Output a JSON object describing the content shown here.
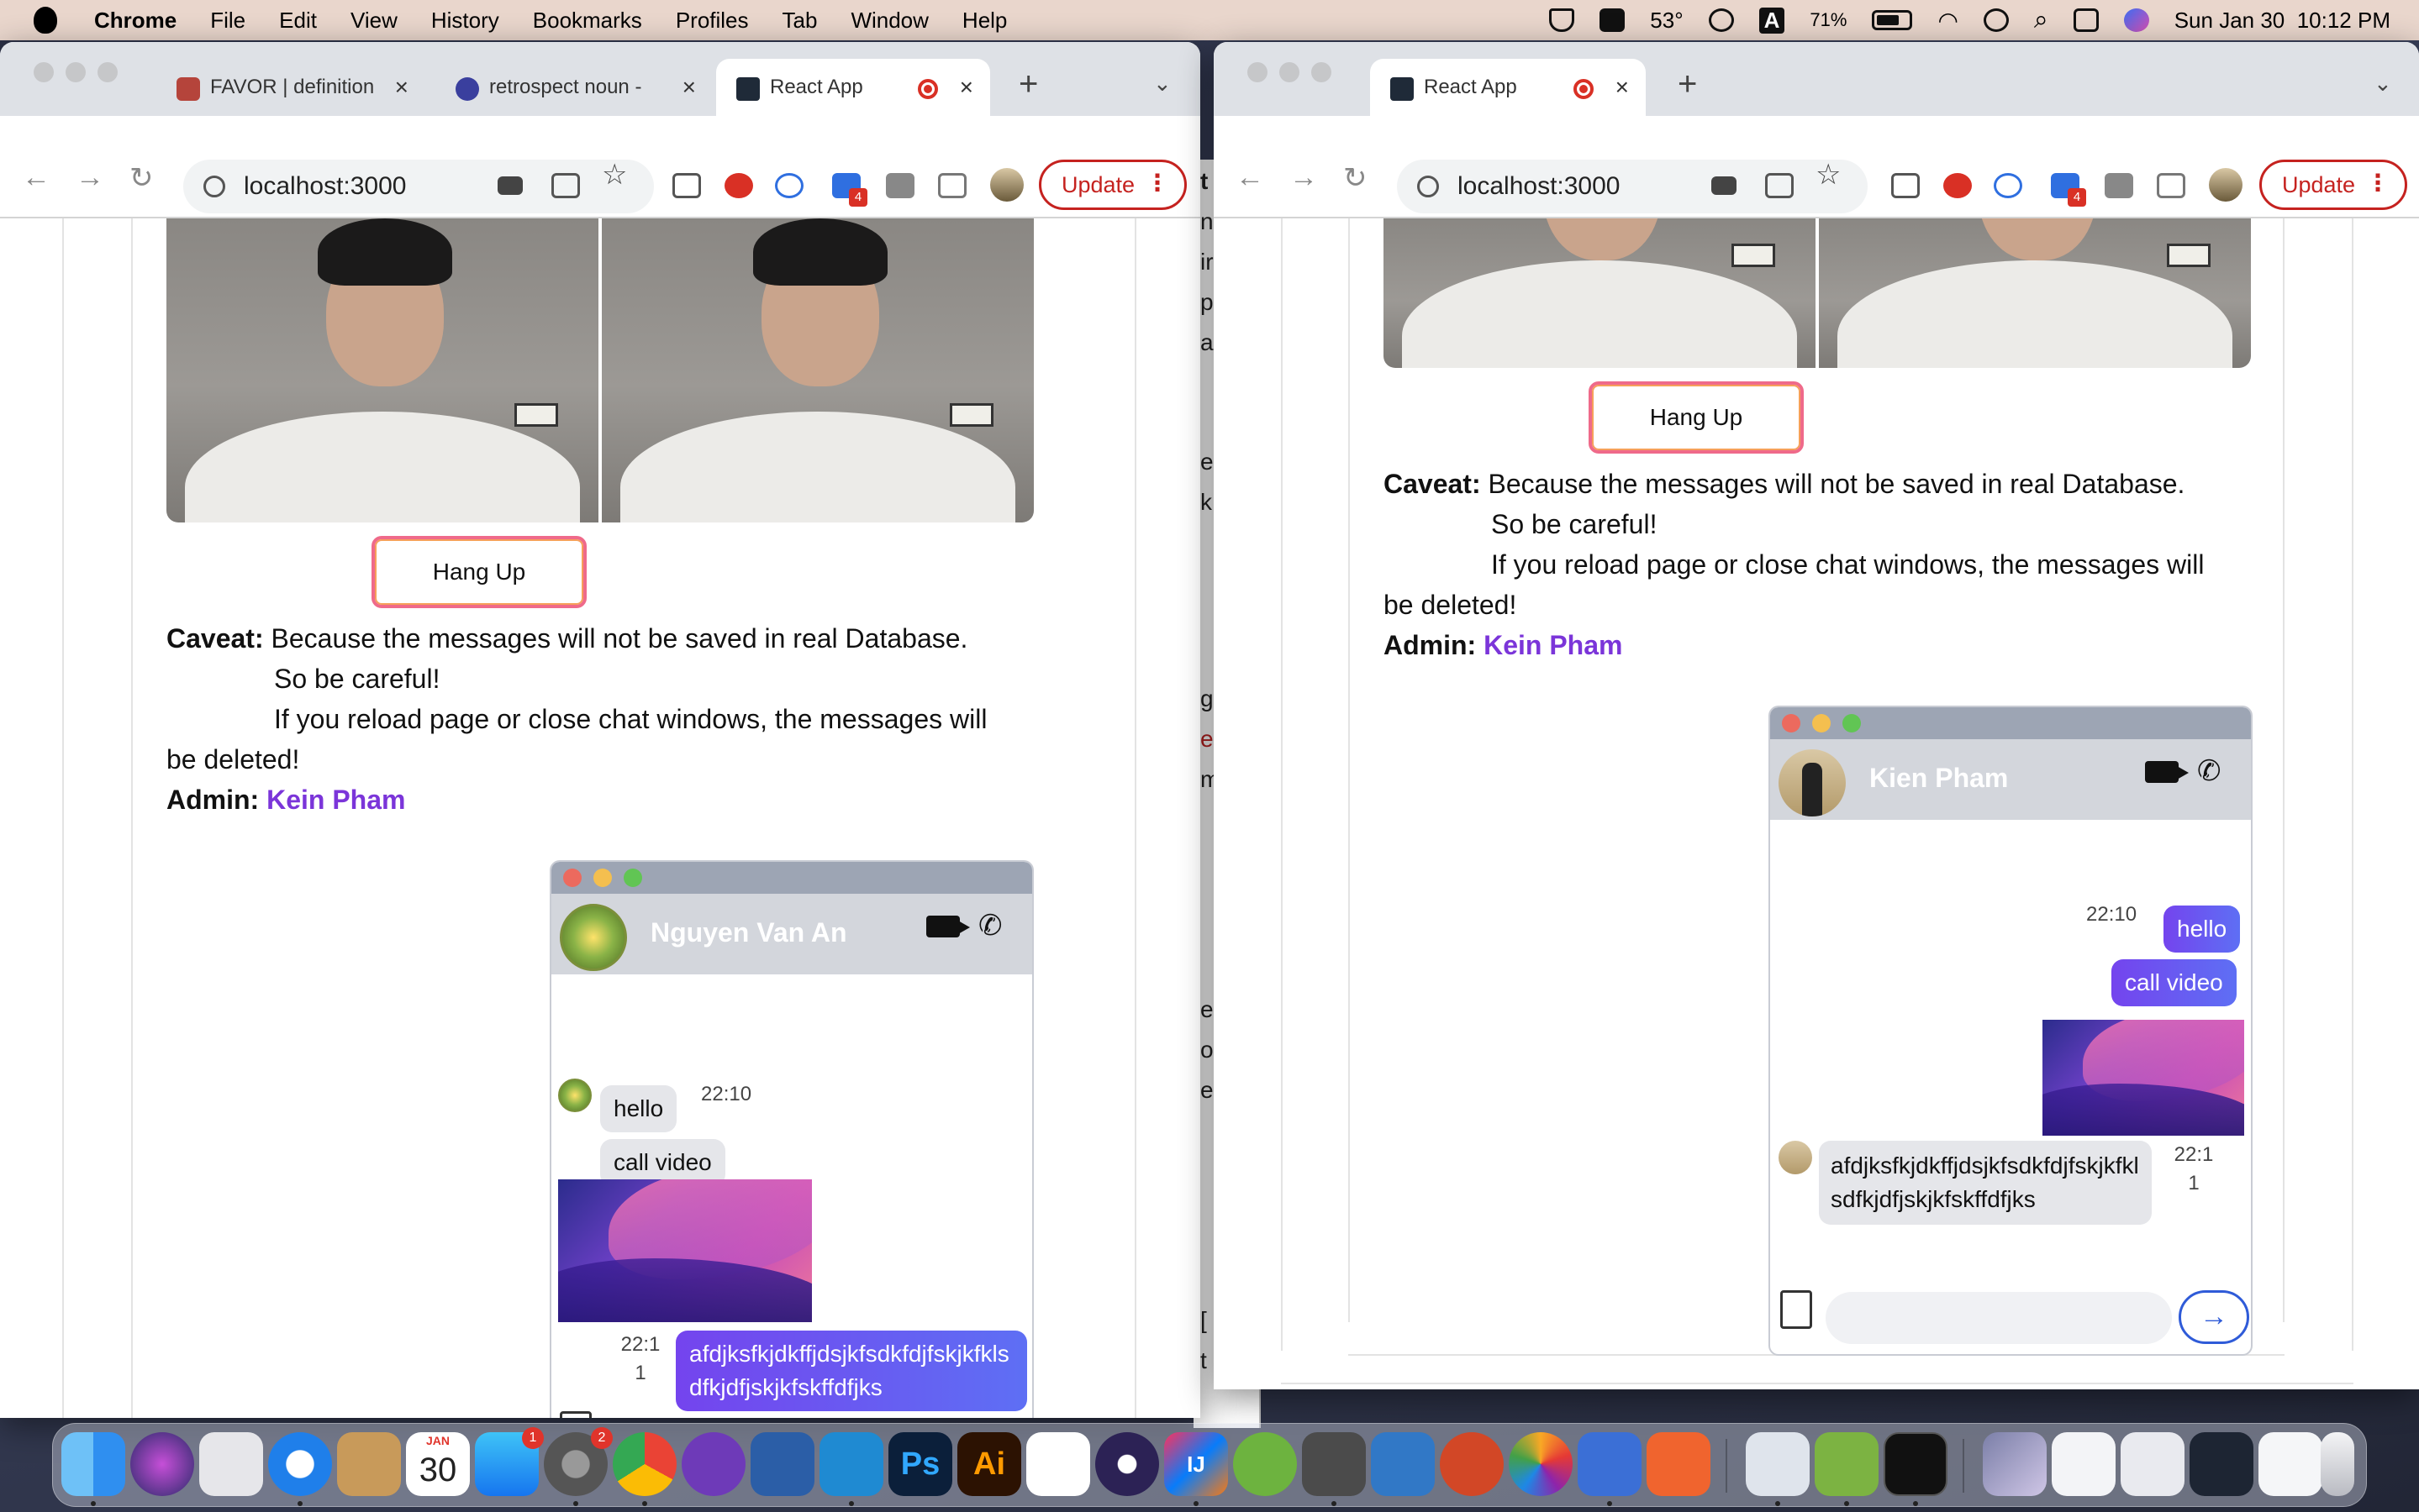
{
  "menubar": {
    "app": "Chrome",
    "items": [
      "File",
      "Edit",
      "View",
      "History",
      "Bookmarks",
      "Profiles",
      "Tab",
      "Window",
      "Help"
    ],
    "weather": "53°",
    "input_source": "A",
    "battery": "71%",
    "clock": "Sun Jan 30  10:12 PM"
  },
  "left_window": {
    "tabs": [
      {
        "label": "FAVOR | definition",
        "favicon_color": "#b5443b"
      },
      {
        "label": "retrospect noun -",
        "favicon_color": "#3a3f9e"
      },
      {
        "label": "React App",
        "favicon_color": "#1f2a38"
      }
    ],
    "address": "localhost:3000",
    "update_label": "Update",
    "ext_badge": "4",
    "hangup_label": "Hang Up",
    "caveat": {
      "label": "Caveat:",
      "line1": "Because the messages will not be saved in real Database.",
      "line2": "So be careful!",
      "line3": "If you reload page or close chat windows, the messages will",
      "line4": "be deleted!",
      "admin_label": "Admin:",
      "admin_name": "Kein Pham"
    },
    "chat": {
      "contact_name": "Nguyen Van An",
      "messages": {
        "m1": "hello",
        "m1_time": "22:10",
        "m2": "call video",
        "m4": "afdjksfkjdkffjdsjkfsdkfdjfskjkfklsdfkjdfjskjkfskffdfjks",
        "m4_time": "22:11"
      }
    }
  },
  "right_window": {
    "tabs": [
      {
        "label": "React App",
        "favicon_color": "#1f2a38"
      }
    ],
    "address": "localhost:3000",
    "update_label": "Update",
    "ext_badge": "4",
    "hangup_label": "Hang Up",
    "caveat": {
      "label": "Caveat:",
      "line1": "Because the messages will not be saved in real Database.",
      "line2": "So be careful!",
      "line3": "If you reload page or close chat windows, the messages will",
      "line4": "be deleted!",
      "admin_label": "Admin:",
      "admin_name": "Kein Pham"
    },
    "chat": {
      "contact_name": "Kien Pham",
      "messages": {
        "m1": "hello",
        "m1_time": "22:10",
        "m2": "call video",
        "m4": "afdjksfkjdkffjdsjkfsdkfdjfskjkfklsdfkjdfjskjkfskffdfjks",
        "m4_time": "22:11"
      }
    }
  },
  "background_window_letters": [
    "t",
    "n",
    "ir",
    "p",
    "a",
    "e",
    "k",
    "g",
    "e",
    "m",
    "e",
    "o",
    "e",
    "[",
    "t"
  ],
  "dock": {
    "calendar_month": "JAN",
    "calendar_day": "30",
    "appstore_badge": "1",
    "settings_badge": "2",
    "photoshop_label": "Ps",
    "illustrator_label": "Ai",
    "intellij_label": "IJ"
  },
  "colors": {
    "accent_purple": "#6f4cf5",
    "admin_purple": "#7b35d9",
    "update_red": "#c5221f"
  }
}
